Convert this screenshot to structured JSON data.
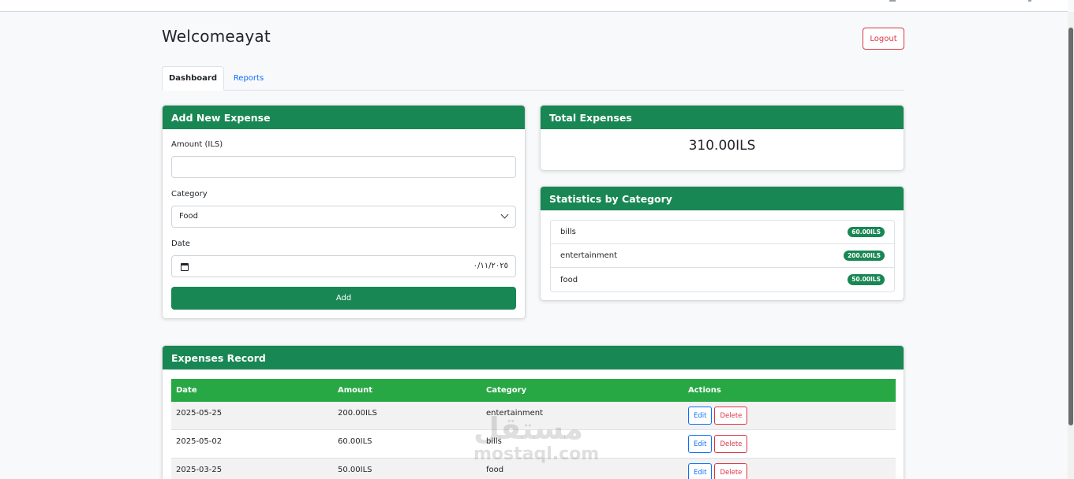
{
  "header": {
    "welcome": "Welcomeayat",
    "logout_label": "Logout"
  },
  "tabs": [
    {
      "label": "Dashboard",
      "active": true
    },
    {
      "label": "Reports",
      "active": false
    }
  ],
  "add_expense": {
    "title": "Add New Expense",
    "amount_label": "Amount (ILS)",
    "amount_value": "",
    "category_label": "Category",
    "category_value": "Food",
    "date_label": "Date",
    "date_value": "٠/١١/٢٠٢٥",
    "add_label": "Add"
  },
  "total": {
    "title": "Total Expenses",
    "value": "310.00ILS"
  },
  "stats": {
    "title": "Statistics by Category",
    "items": [
      {
        "name": "bills",
        "amount": "60.00ILS"
      },
      {
        "name": "entertainment",
        "amount": "200.00ILS"
      },
      {
        "name": "food",
        "amount": "50.00ILS"
      }
    ]
  },
  "records": {
    "title": "Expenses Record",
    "columns": [
      "Date",
      "Amount",
      "Category",
      "Actions"
    ],
    "rows": [
      {
        "date": "2025-05-25",
        "amount": "200.00ILS",
        "category": "entertainment"
      },
      {
        "date": "2025-05-02",
        "amount": "60.00ILS",
        "category": "bills"
      },
      {
        "date": "2025-03-25",
        "amount": "50.00ILS",
        "category": "food"
      }
    ],
    "edit_label": "Edit",
    "delete_label": "Delete"
  },
  "watermark": {
    "logo": "مستقل",
    "text": "mostaql.com"
  },
  "colors": {
    "primary_green": "#198754",
    "table_header_green": "#28a745",
    "danger": "#dc3545",
    "link_blue": "#0d6efd"
  }
}
